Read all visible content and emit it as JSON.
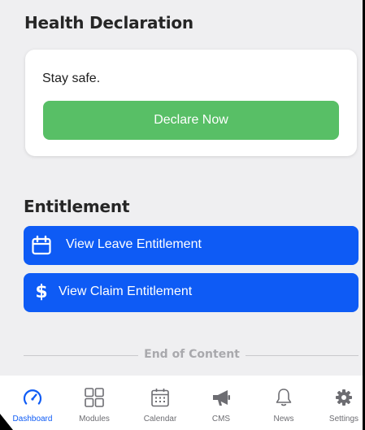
{
  "health": {
    "title": "Health Declaration",
    "card_text": "Stay safe.",
    "declare_button": "Declare Now"
  },
  "entitlement": {
    "title": "Entitlement",
    "leave_button": "View Leave Entitlement",
    "claim_button": "View Claim Entitlement",
    "leave_icon": "calendar-icon",
    "claim_icon": "dollar-icon"
  },
  "footer": {
    "end_text": "End of Content"
  },
  "tabbar": {
    "active": "Dashboard",
    "items": [
      {
        "label": "Dashboard",
        "icon": "speedometer-icon"
      },
      {
        "label": "Modules",
        "icon": "grid-icon"
      },
      {
        "label": "Calendar",
        "icon": "calendar-icon"
      },
      {
        "label": "CMS",
        "icon": "megaphone-icon"
      },
      {
        "label": "News",
        "icon": "bell-icon"
      },
      {
        "label": "Settings",
        "icon": "gear-icon"
      }
    ]
  },
  "colors": {
    "background": "#efeff1",
    "green": "#58bf66",
    "blue": "#0e5bf5",
    "active_tab": "#0e5bf5",
    "inactive_tab": "#6d6d72"
  }
}
